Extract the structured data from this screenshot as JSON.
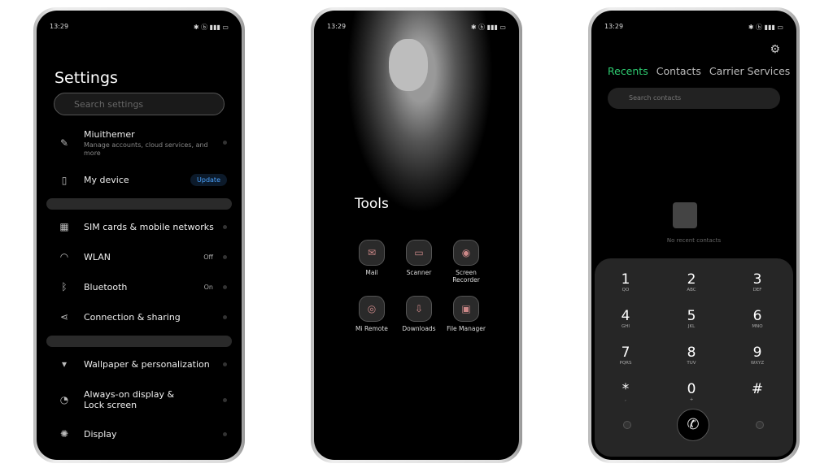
{
  "status": {
    "time": "13:29",
    "icons": "✱ ⓑ ▮▮▮ ▭"
  },
  "settings": {
    "title": "Settings",
    "search_placeholder": "Search settings",
    "items": [
      {
        "label": "Miuithemer",
        "sub": "Manage accounts, cloud services, and more",
        "icon": "✎"
      },
      {
        "label": "My device",
        "badge": "Update",
        "icon": "▯"
      },
      {
        "label": "SIM cards & mobile networks",
        "icon": "▦"
      },
      {
        "label": "WLAN",
        "value": "Off",
        "icon": "◠"
      },
      {
        "label": "Bluetooth",
        "value": "On",
        "icon": "ᛒ"
      },
      {
        "label": "Connection & sharing",
        "icon": "⋖"
      },
      {
        "label": "Wallpaper & personalization",
        "icon": "▾"
      },
      {
        "label": "Always-on display & Lock screen",
        "icon": "◔"
      },
      {
        "label": "Display",
        "icon": "✺"
      }
    ]
  },
  "home": {
    "folder": "Tools",
    "apps": [
      {
        "label": "Mail",
        "icon": "✉"
      },
      {
        "label": "Scanner",
        "icon": "▭"
      },
      {
        "label": "Screen Recorder",
        "icon": "◉"
      },
      {
        "label": "Mi Remote",
        "icon": "◎"
      },
      {
        "label": "Downloads",
        "icon": "⇩"
      },
      {
        "label": "File Manager",
        "icon": "▣"
      }
    ]
  },
  "dialer": {
    "tabs": [
      "Recents",
      "Contacts",
      "Carrier Services"
    ],
    "active_tab_color": "#2ecc71",
    "search_placeholder": "Search contacts",
    "empty": "No recent contacts",
    "keys": [
      [
        "1",
        "QO"
      ],
      [
        "2",
        "ABC"
      ],
      [
        "3",
        "DEF"
      ],
      [
        "4",
        "GHI"
      ],
      [
        "5",
        "JKL"
      ],
      [
        "6",
        "MNO"
      ],
      [
        "7",
        "PQRS"
      ],
      [
        "8",
        "TUV"
      ],
      [
        "9",
        "WXYZ"
      ],
      [
        "*",
        ","
      ],
      [
        "0",
        "+"
      ],
      [
        "#",
        ""
      ]
    ],
    "call_icon": "✆",
    "gear_icon": "⚙"
  }
}
